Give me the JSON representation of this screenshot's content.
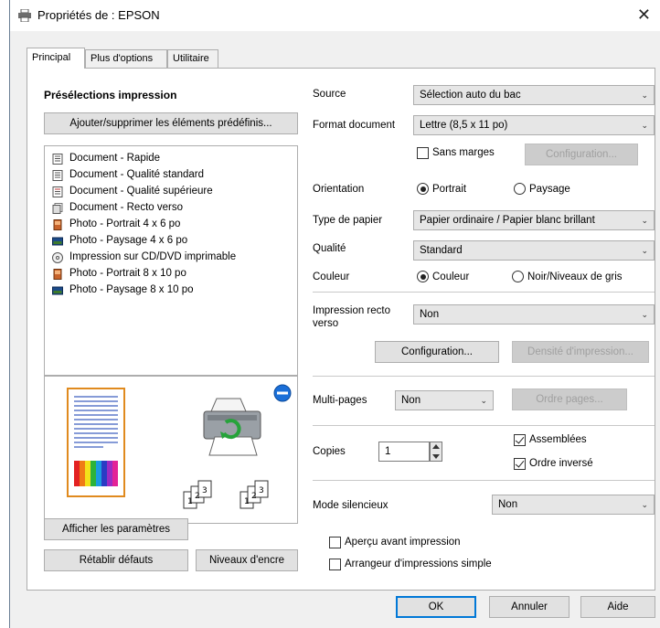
{
  "window": {
    "title": "Propriétés de : EPSON"
  },
  "tabs": [
    {
      "label": "Principal"
    },
    {
      "label": "Plus d'options"
    },
    {
      "label": "Utilitaire"
    }
  ],
  "presets": {
    "heading": "Présélections impression",
    "add_remove_button": "Ajouter/supprimer les éléments prédéfinis...",
    "items": [
      {
        "label": "Document - Rapide",
        "icon": "document-icon"
      },
      {
        "label": "Document - Qualité standard",
        "icon": "document-icon"
      },
      {
        "label": "Document - Qualité supérieure",
        "icon": "document-icon"
      },
      {
        "label": "Document - Recto verso",
        "icon": "duplex-document-icon"
      },
      {
        "label": "Photo - Portrait 4 x 6 po",
        "icon": "photo-portrait-icon"
      },
      {
        "label": "Photo - Paysage 4 x 6 po",
        "icon": "photo-landscape-icon"
      },
      {
        "label": "Impression sur CD/DVD imprimable",
        "icon": "cd-icon"
      },
      {
        "label": "Photo - Portrait 8 x 10 po",
        "icon": "photo-portrait-icon"
      },
      {
        "label": "Photo - Paysage 8 x 10 po",
        "icon": "photo-landscape-icon"
      }
    ]
  },
  "settings": {
    "source_label": "Source",
    "source_value": "Sélection auto du bac",
    "format_label": "Format document",
    "format_value": "Lettre (8,5 x 11 po)",
    "borderless_label": "Sans marges",
    "borderless_config_button": "Configuration...",
    "orientation_label": "Orientation",
    "orientation_portrait": "Portrait",
    "orientation_landscape": "Paysage",
    "paper_type_label": "Type de papier",
    "paper_type_value": "Papier ordinaire / Papier blanc brillant",
    "quality_label": "Qualité",
    "quality_value": "Standard",
    "color_label": "Couleur",
    "color_option": "Couleur",
    "grayscale_option": "Noir/Niveaux de gris",
    "duplex_label_line1": "Impression recto",
    "duplex_label_line2": "verso",
    "duplex_value": "Non",
    "duplex_config_button": "Configuration...",
    "print_density_button": "Densité d'impression...",
    "multipage_label": "Multi-pages",
    "multipage_value": "Non",
    "page_order_button": "Ordre pages...",
    "copies_label": "Copies",
    "copies_value": "1",
    "collate_label": "Assemblées",
    "reverse_label": "Ordre inversé",
    "quiet_mode_label": "Mode silencieux",
    "quiet_mode_value": "Non",
    "preview_label": "Aperçu avant impression",
    "job_arranger_label": "Arrangeur d'impressions simple"
  },
  "left_buttons": {
    "show_settings": "Afficher les paramètres",
    "restore_defaults": "Rétablir défauts",
    "ink_levels": "Niveaux d'encre"
  },
  "dialog_buttons": {
    "ok": "OK",
    "cancel": "Annuler",
    "help": "Aide"
  },
  "colors": {
    "accent": "#0078d7",
    "panel_border": "#adadad"
  }
}
